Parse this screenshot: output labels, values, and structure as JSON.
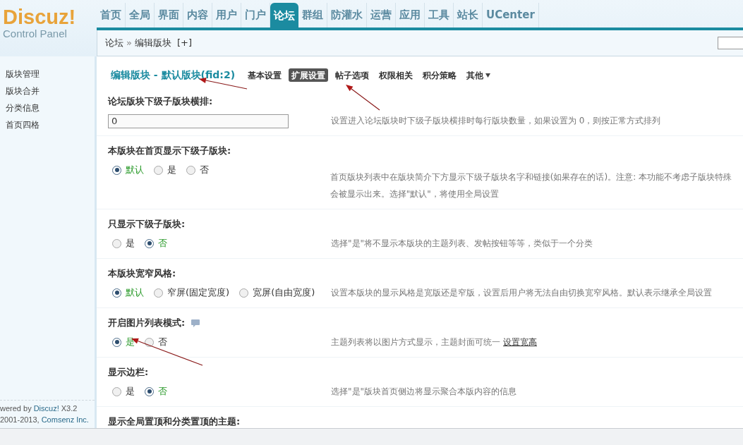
{
  "logo": {
    "title": "Discuz!",
    "subtitle": "Control Panel"
  },
  "nav": [
    {
      "label": "首页",
      "selected": false
    },
    {
      "label": "全局",
      "selected": false
    },
    {
      "label": "界面",
      "selected": false
    },
    {
      "label": "内容",
      "selected": false
    },
    {
      "label": "用户",
      "selected": false
    },
    {
      "label": "门户",
      "selected": false
    },
    {
      "label": "论坛",
      "selected": true
    },
    {
      "label": "群组",
      "selected": false
    },
    {
      "label": "防灌水",
      "selected": false
    },
    {
      "label": "运营",
      "selected": false
    },
    {
      "label": "应用",
      "selected": false
    },
    {
      "label": "工具",
      "selected": false
    },
    {
      "label": "站长",
      "selected": false
    },
    {
      "label": "UCenter",
      "selected": false
    }
  ],
  "breadcrumb": {
    "parent": "论坛",
    "separator": "»",
    "current": "编辑版块",
    "add": "[+]"
  },
  "sidebar": {
    "items": [
      "版块管理",
      "版块合并",
      "分类信息",
      "首页四格"
    ],
    "footer": [
      {
        "prefix": "wered by",
        "link": "Discuz!",
        "suffix": "X3.2"
      },
      {
        "prefix": "2001-2013,",
        "link": "Comsenz Inc."
      }
    ]
  },
  "page_title": {
    "text": "编辑版块 - 默认版块(fid:2)"
  },
  "tabs": [
    {
      "label": "基本设置",
      "selected": false
    },
    {
      "label": "扩展设置",
      "selected": true
    },
    {
      "label": "帖子选项",
      "selected": false
    },
    {
      "label": "权限相关",
      "selected": false
    },
    {
      "label": "积分策略",
      "selected": false
    },
    {
      "label": "其他",
      "selected": false,
      "dropdown": true
    }
  ],
  "settings": [
    {
      "kind": "text",
      "label": "论坛版块下级子版块横排:",
      "value": "0",
      "description": [
        "设置进入论坛版块时下级子版块横排时每行版块数量，如果设置为 0，则按正常方式排列"
      ]
    },
    {
      "kind": "radio",
      "label": "本版块在首页显示下级子版块:",
      "options": [
        {
          "label": "默认",
          "selected": true
        },
        {
          "label": "是",
          "selected": false
        },
        {
          "label": "否",
          "selected": false
        }
      ],
      "description": [
        "首页版块列表中在版块简介下方显示下级子版块名字和链接(如果存在的话)。注意: 本功能不考虑子版块特殊",
        "会被显示出来。选择\"默认\"，将使用全局设置"
      ]
    },
    {
      "kind": "radio",
      "label": "只显示下级子版块:",
      "options": [
        {
          "label": "是",
          "selected": false
        },
        {
          "label": "否",
          "selected": true
        }
      ],
      "description": [
        "选择\"是\"将不显示本版块的主题列表、发帖按钮等等，类似于一个分类"
      ]
    },
    {
      "kind": "radio",
      "label": "本版块宽窄风格:",
      "options": [
        {
          "label": "默认",
          "selected": true
        },
        {
          "label": "窄屏(固定宽度)",
          "selected": false
        },
        {
          "label": "宽屏(自由宽度)",
          "selected": false
        }
      ],
      "description": [
        "设置本版块的显示风格是宽版还是窄版，设置后用户将无法自由切换宽窄风格。默认表示继承全局设置"
      ]
    },
    {
      "kind": "radio",
      "label": "开启图片列表模式:",
      "help": true,
      "options": [
        {
          "label": "是",
          "selected": true
        },
        {
          "label": "否",
          "selected": false
        }
      ],
      "description": [
        "主题列表将以图片方式显示，主题封面可统一"
      ],
      "link": "设置宽高"
    },
    {
      "kind": "radio",
      "label": "显示边栏:",
      "options": [
        {
          "label": "是",
          "selected": false
        },
        {
          "label": "否",
          "selected": true
        }
      ],
      "description": [
        "选择\"是\"版块首页侧边将显示聚合本版内容的信息"
      ]
    },
    {
      "kind": "heading",
      "label": "显示全局置顶和分类置顶的主题:"
    }
  ]
}
